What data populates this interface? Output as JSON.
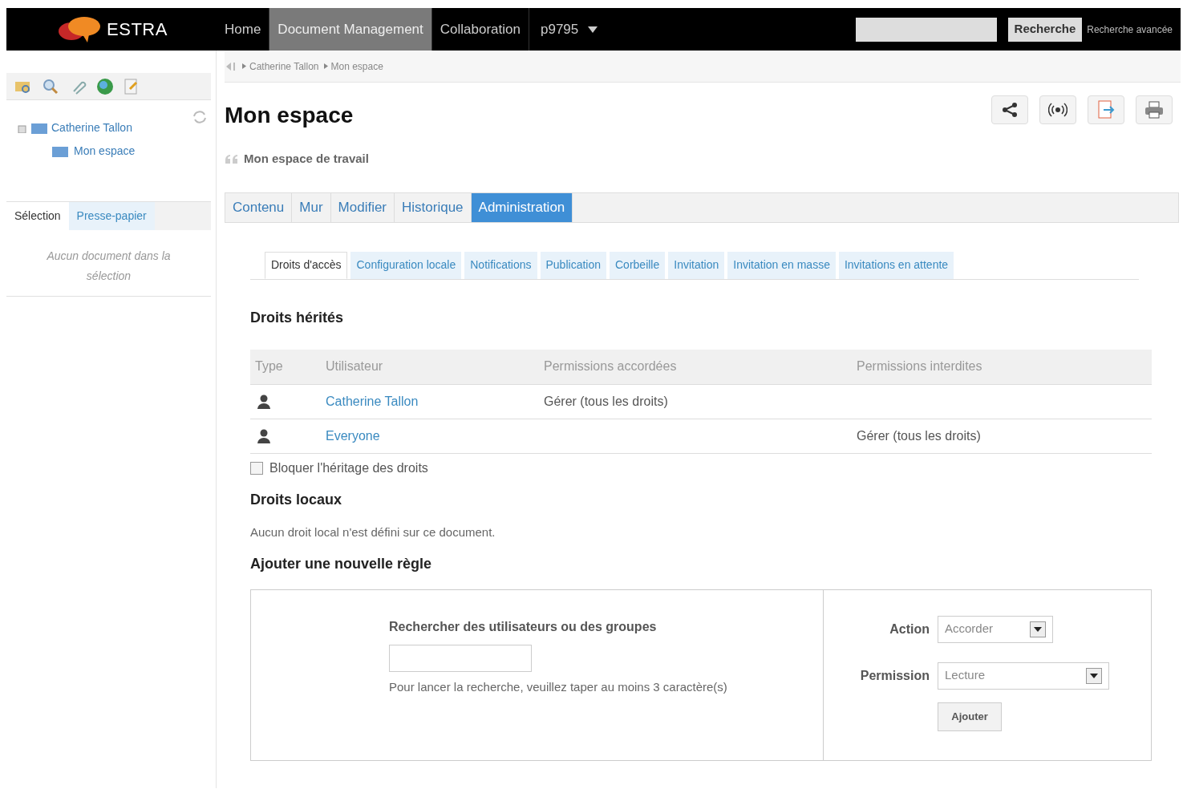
{
  "topbar": {
    "logo": "ESTRA",
    "nav": [
      {
        "label": "Home",
        "selected": false
      },
      {
        "label": "Document Management",
        "selected": true
      },
      {
        "label": "Collaboration",
        "selected": false
      }
    ],
    "workspace_menu": "p9795",
    "search_button": "Recherche",
    "advanced_search": "Recherche avancée"
  },
  "sidebar": {
    "tree": [
      {
        "label": "Catherine Tallon",
        "children": [
          {
            "label": "Mon espace"
          }
        ]
      }
    ],
    "tabs": [
      {
        "label": "Sélection",
        "selected": true
      },
      {
        "label": "Presse-papier",
        "selected": false
      }
    ],
    "empty_message": "Aucun document dans la sélection"
  },
  "breadcrumb": [
    "Catherine Tallon",
    "Mon espace"
  ],
  "title": "Mon espace",
  "description": "Mon espace de travail",
  "main_tabs": [
    {
      "label": "Contenu",
      "selected": false
    },
    {
      "label": "Mur",
      "selected": false
    },
    {
      "label": "Modifier",
      "selected": false
    },
    {
      "label": "Historique",
      "selected": false
    },
    {
      "label": "Administration",
      "selected": true
    }
  ],
  "sub_tabs": [
    {
      "label": "Droits d'accès",
      "selected": true
    },
    {
      "label": "Configuration locale",
      "selected": false
    },
    {
      "label": "Notifications",
      "selected": false
    },
    {
      "label": "Publication",
      "selected": false
    },
    {
      "label": "Corbeille",
      "selected": false
    },
    {
      "label": "Invitation",
      "selected": false
    },
    {
      "label": "Invitation en masse",
      "selected": false
    },
    {
      "label": "Invitations en attente",
      "selected": false
    }
  ],
  "inherited": {
    "heading": "Droits hérités",
    "columns": [
      "Type",
      "Utilisateur",
      "Permissions accordées",
      "Permissions interdites"
    ],
    "rows": [
      {
        "user": "Catherine Tallon",
        "granted": "Gérer (tous les droits)",
        "denied": ""
      },
      {
        "user": "Everyone",
        "granted": "",
        "denied": "Gérer (tous les droits)"
      }
    ],
    "block_inheritance": {
      "label": "Bloquer l'héritage des droits",
      "checked": false
    }
  },
  "local": {
    "heading": "Droits locaux",
    "message": "Aucun droit local n'est défini sur ce document."
  },
  "new_rule": {
    "heading": "Ajouter une nouvelle règle",
    "search_label": "Rechercher des utilisateurs ou des groupes",
    "search_hint": "Pour lancer la recherche, veuillez taper au moins 3 caractère(s)",
    "action_label": "Action",
    "action_value": "Accorder",
    "permission_label": "Permission",
    "permission_value": "Lecture",
    "add_button": "Ajouter"
  }
}
